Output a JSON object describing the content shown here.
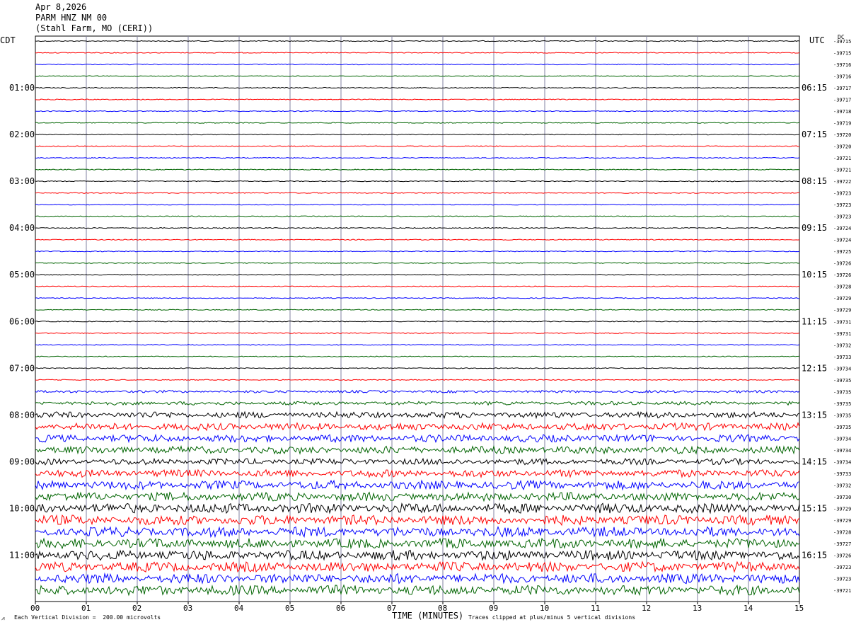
{
  "header": {
    "date": "Apr 8,2026",
    "station": "PARM HNZ NM 00",
    "location": "(Stahl Farm, MO (CERI))"
  },
  "left_axis_label": "CDT",
  "right_axis_label": "UTC",
  "dc_label": "DC",
  "footer": {
    "scale_note": "Each Vertical Division =  200.00 microvolts",
    "xlabel": "TIME (MINUTES)",
    "clip_note": "Traces clipped at plus/minus 5 vertical divisions"
  },
  "chart_data": {
    "type": "line",
    "title": "PARM HNZ NM 00",
    "xlabel": "TIME (MINUTES)",
    "x_range": [
      0,
      15
    ],
    "x_ticks": [
      "00",
      "01",
      "02",
      "03",
      "04",
      "05",
      "06",
      "07",
      "08",
      "09",
      "10",
      "11",
      "12",
      "13",
      "14",
      "15"
    ],
    "left_hour_labels": [
      "01:00",
      "02:00",
      "03:00",
      "04:00",
      "05:00",
      "06:00",
      "07:00",
      "08:00",
      "09:00",
      "10:00",
      "11:00"
    ],
    "right_hour_labels": [
      "06:15",
      "07:15",
      "08:15",
      "09:15",
      "10:15",
      "11:15",
      "12:15",
      "13:15",
      "14:15",
      "15:15",
      "16:15"
    ],
    "trace_colors": [
      "#000000",
      "#ff0000",
      "#0000ff",
      "#006400"
    ],
    "dc_offsets": [
      -39715,
      -39715,
      -39716,
      -39716,
      -39717,
      -39717,
      -39718,
      -39719,
      -39720,
      -39720,
      -39721,
      -39721,
      -39722,
      -39723,
      -39723,
      -39723,
      -39724,
      -39724,
      -39725,
      -39726,
      -39726,
      -39728,
      -39729,
      -39729,
      -39731,
      -39731,
      -39732,
      -39733,
      -39734,
      -39735,
      -39735,
      -39735,
      -39735,
      -39735,
      -39734,
      -39734,
      -39734,
      -39733,
      -39732,
      -39730,
      -39729,
      -39729,
      -39728,
      -39727,
      -39726,
      -39723,
      -39723,
      -39721
    ],
    "trace_noise_level": [
      1,
      1,
      1,
      1,
      1,
      1,
      1,
      1,
      1,
      1,
      1,
      1,
      1,
      1,
      1,
      1,
      1,
      1,
      1,
      1,
      1,
      1,
      1,
      1,
      1,
      1,
      1,
      1,
      1,
      1,
      2,
      3,
      5,
      6,
      6,
      6,
      5,
      6,
      7,
      7,
      8,
      8,
      8,
      8,
      8,
      8,
      8,
      8
    ]
  }
}
